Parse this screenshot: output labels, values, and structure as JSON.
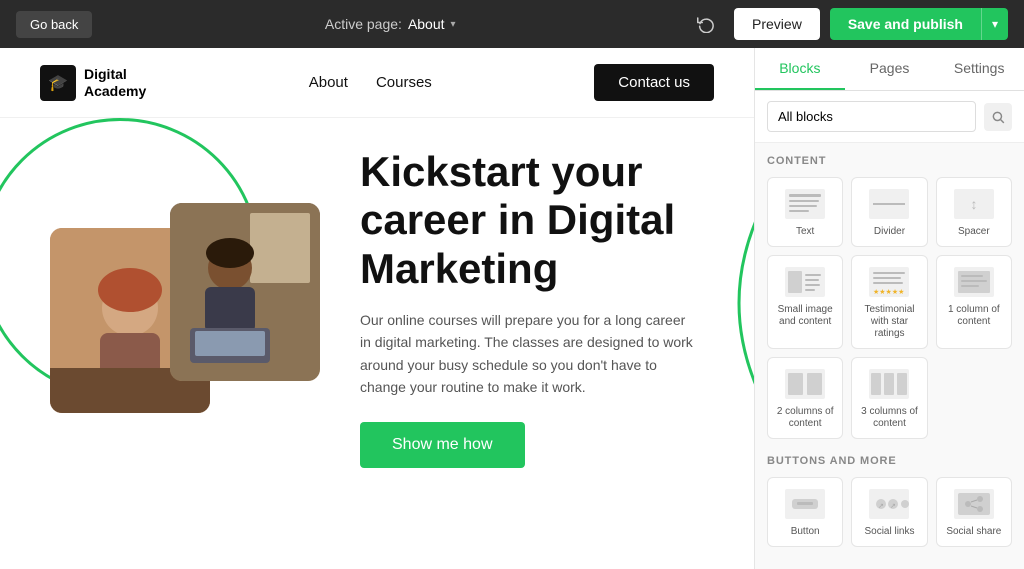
{
  "topbar": {
    "go_back": "Go back",
    "active_page_label": "Active page:",
    "active_page_name": "About",
    "preview_label": "Preview",
    "save_publish_label": "Save and publish"
  },
  "site": {
    "logo_name_line1": "Digital",
    "logo_name_line2": "Academy",
    "nav": [
      {
        "label": "About"
      },
      {
        "label": "Courses"
      }
    ],
    "contact_label": "Contact us"
  },
  "hero": {
    "title": "Kickstart your career in Digital Marketing",
    "description": "Our online courses will prepare you for a long career in digital marketing. The classes are designed to work around your busy schedule so you don't have to change your routine to make it work.",
    "cta_label": "Show me how"
  },
  "right_panel": {
    "tabs": [
      {
        "label": "Blocks",
        "active": true
      },
      {
        "label": "Pages",
        "active": false
      },
      {
        "label": "Settings",
        "active": false
      }
    ],
    "select_placeholder": "All blocks",
    "sections": {
      "content": {
        "label": "CONTENT",
        "blocks": [
          {
            "id": "text",
            "label": "Text"
          },
          {
            "id": "divider",
            "label": "Divider"
          },
          {
            "id": "spacer",
            "label": "Spacer"
          },
          {
            "id": "small-image-content",
            "label": "Small image and content"
          },
          {
            "id": "testimonial",
            "label": "Testimonial with star ratings"
          },
          {
            "id": "1col",
            "label": "1 column of content"
          },
          {
            "id": "2col",
            "label": "2 columns of content"
          },
          {
            "id": "3col",
            "label": "3 columns of content"
          }
        ]
      },
      "buttons": {
        "label": "BUTTONS AND MORE",
        "blocks": [
          {
            "id": "button",
            "label": "Button"
          },
          {
            "id": "social-links",
            "label": "Social links"
          },
          {
            "id": "social-share",
            "label": "Social share"
          }
        ]
      }
    }
  }
}
